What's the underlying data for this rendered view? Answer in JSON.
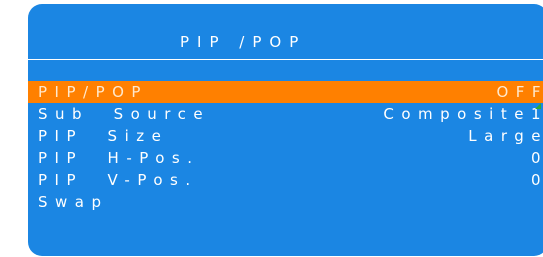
{
  "title": "PIP /POP",
  "menu": {
    "items": [
      {
        "label": "PIP/POP",
        "value": "OFF"
      },
      {
        "label": "Sub  Source",
        "value": "Composite1"
      },
      {
        "label": "PIP  Size",
        "value": "Large"
      },
      {
        "label": "PIP  H-Pos.",
        "value": "0"
      },
      {
        "label": "PIP  V-Pos.",
        "value": "0"
      },
      {
        "label": "Swap",
        "value": ""
      }
    ],
    "selected_index": 0
  },
  "colors": {
    "panel_bg": "#1b86e3",
    "highlight": "#ff8000",
    "text": "#ffffff"
  }
}
